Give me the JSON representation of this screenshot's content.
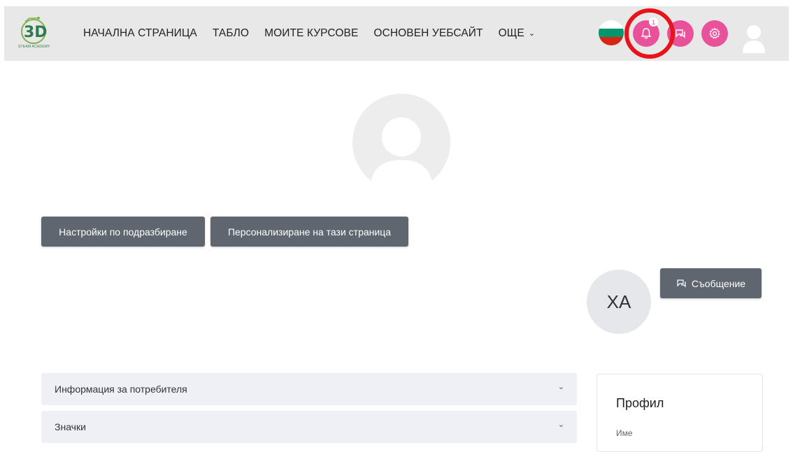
{
  "logo": {
    "text": "STEAM ACADEMY",
    "mark": "3D"
  },
  "nav": {
    "links": [
      "НАЧАЛНА СТРАНИЦА",
      "ТАБЛО",
      "МОИТЕ КУРСОВЕ",
      "ОСНОВЕН УЕБСАЙТ"
    ],
    "more_label": "ОЩЕ"
  },
  "header_icons": {
    "language_flag": "bulgaria-flag-icon",
    "notifications_count": "1",
    "accent_color": "#e9529a",
    "highlight_ring_color": "#e8141c"
  },
  "page": {
    "reset_button": "Настройки по подразбиране",
    "customize_button": "Персонализиране на тази страница",
    "user_initials": "ХА",
    "message_button": "Съобщение"
  },
  "sections": [
    {
      "label": "Информация за потребителя"
    },
    {
      "label": "Значки"
    }
  ],
  "profile_card": {
    "title": "Профил",
    "field_label": "Име"
  }
}
